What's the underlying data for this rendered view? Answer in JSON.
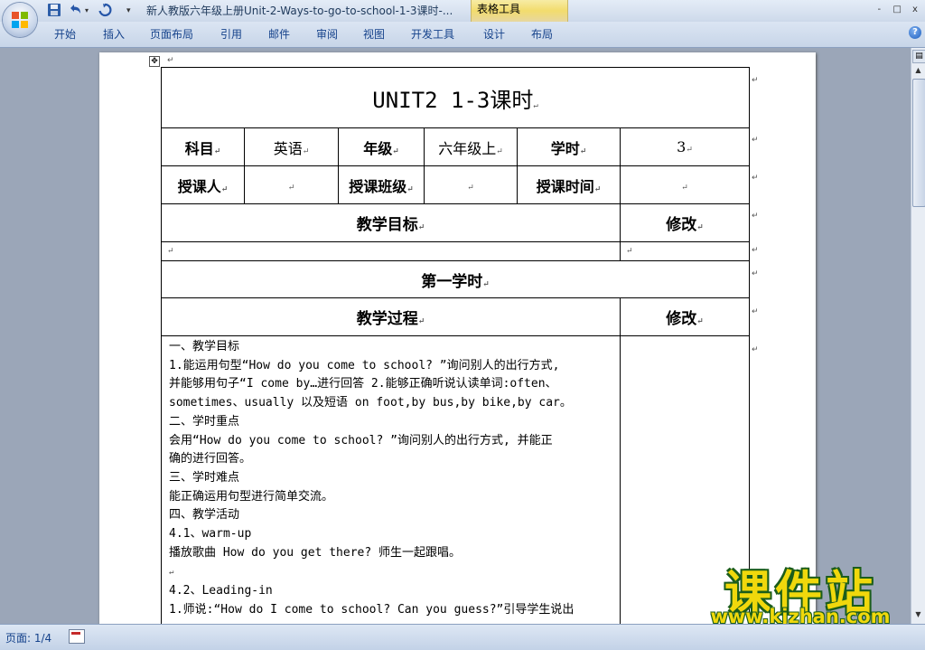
{
  "window": {
    "title": "新人教版六年级上册Unit-2-Ways-to-go-to-school-1-3课时-...",
    "context_group": "表格工具",
    "controls": [
      "-",
      "□",
      "x"
    ]
  },
  "ribbon": {
    "tabs": [
      "开始",
      "插入",
      "页面布局",
      "引用",
      "邮件",
      "审阅",
      "视图",
      "开发工具",
      "设计",
      "布局"
    ],
    "help": "?"
  },
  "document": {
    "title": "UNIT2 1-3课时",
    "info_row1": {
      "subject_label": "科目",
      "subject_value": "英语",
      "grade_label": "年级",
      "grade_value": "六年级上",
      "hours_label": "学时",
      "hours_value": "3"
    },
    "info_row2": {
      "teacher_label": "授课人",
      "class_label": "授课班级",
      "time_label": "授课时间"
    },
    "goals_header": "教学目标",
    "revise_header": "修改",
    "section_title": "第一学时",
    "process_header": "教学过程",
    "revise_header2": "修改",
    "content_lines": [
      "一、教学目标",
      "1.能运用句型“How do you come to school? ”询问别人的出行方式,",
      "并能够用句子“I come by…进行回答 2.能够正确听说认读单词:often、",
      "sometimes、usually 以及短语 on foot,by bus,by bike,by car。",
      "二、学时重点",
      "会用“How do you come to school? ”询问别人的出行方式, 并能正",
      "确的进行回答。",
      "三、学时难点",
      "能正确运用句型进行简单交流。",
      "四、教学活动",
      "4.1、warm-up",
      "播放歌曲 How do you get there? 师生一起跟唱。",
      "",
      "4.2、Leading-in",
      "1.师说:“How do I come to school? Can you guess?”引导学生说出"
    ]
  },
  "watermark": {
    "text": "课件站",
    "url": "www.kjzhan.com"
  },
  "statusbar": {
    "page": "页面: 1/4"
  }
}
